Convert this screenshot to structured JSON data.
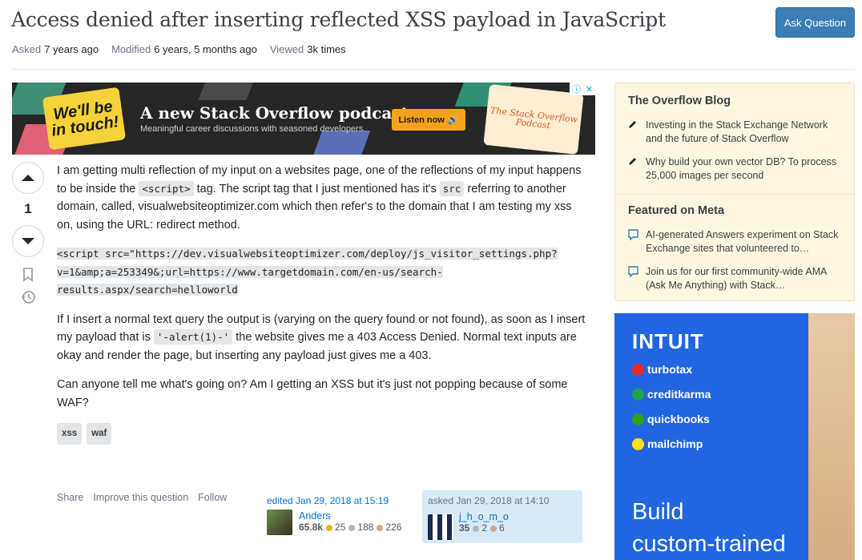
{
  "question": {
    "title": "Access denied after inserting reflected XSS payload in JavaScript",
    "ask_button": "Ask Question",
    "meta": [
      {
        "label": "Asked",
        "value": "7 years ago"
      },
      {
        "label": "Modified",
        "value": "6 years, 5 months ago"
      },
      {
        "label": "Viewed",
        "value": "3k times"
      }
    ],
    "votes": "1",
    "body": {
      "p1_a": "I am getting multi reflection of my input on a websites page, one of the reflections of my input happens to be inside the ",
      "p1_code1": "<script>",
      "p1_b": " tag. The script tag that I just mentioned has it's ",
      "p1_code2": "src",
      "p1_c": " referring to another domain, called, visualwebsiteoptimizer.com which then refer's to the domain that I am testing my xss on, using the URL: redirect method.",
      "code_line1": "<script src=\"https://dev.visualwebsiteoptimizer.com/deploy/js_visitor_settings.php?",
      "code_line2": "v=1&amp;a=253349&;url=https://www.targetdomain.com/en-us/search-",
      "code_line3": "results.aspx/search=helloworld",
      "p2_a": "If I insert a normal text query the output is (varying on the query found or not found), as soon as I insert my payload that is ",
      "p2_code": "'-alert(1)-'",
      "p2_b": " the website gives me a 403 Access Denied. Normal text inputs are okay and render the page, but inserting any payload just gives me a 403.",
      "p3": "Can anyone tell me what's going on? Am I getting an XSS but it's just not popping because of some WAF?"
    },
    "tags": [
      "xss",
      "waf"
    ],
    "footer_links": [
      "Share",
      "Improve this question",
      "Follow"
    ],
    "edited": {
      "label": "edited Jan 29, 2018 at 15:19",
      "name": "Anders",
      "rep": "65.8k",
      "gold": "25",
      "silver": "188",
      "bronze": "226"
    },
    "asked": {
      "label": "asked Jan 29, 2018 at 14:10",
      "name": "j_h_o_m_o",
      "rep": "35",
      "silver": "2",
      "bronze": "6"
    }
  },
  "ad_banner": {
    "speech": "We'll be in touch!",
    "headline": "A new Stack Overflow podcast.",
    "sub": "Meaningful career discussions with seasoned developers.",
    "listen": "Listen now",
    "badge": "The Stack Overflow Podcast"
  },
  "sidebar": {
    "blog_title": "The Overflow Blog",
    "blog_items": [
      "Investing in the Stack Exchange Network and the future of Stack Overflow",
      "Why build your own vector DB? To process 25,000 images per second"
    ],
    "meta_title": "Featured on Meta",
    "meta_items": [
      "AI-generated Answers experiment on Stack Exchange sites that volunteered to…",
      "Join us for our first community-wide AMA (Ask Me Anything) with Stack…"
    ]
  },
  "side_ad": {
    "logo": "INTUIT",
    "brands": [
      "turbotax",
      "creditkarma",
      "quickbooks",
      "mailchimp"
    ],
    "build_line1": "Build",
    "build_line2": "custom-trained"
  },
  "colors": {
    "accent": "#3b7db6",
    "link": "#0074cc",
    "blog_bg": "#fdf7e2",
    "intuit_blue": "#2166e0"
  }
}
